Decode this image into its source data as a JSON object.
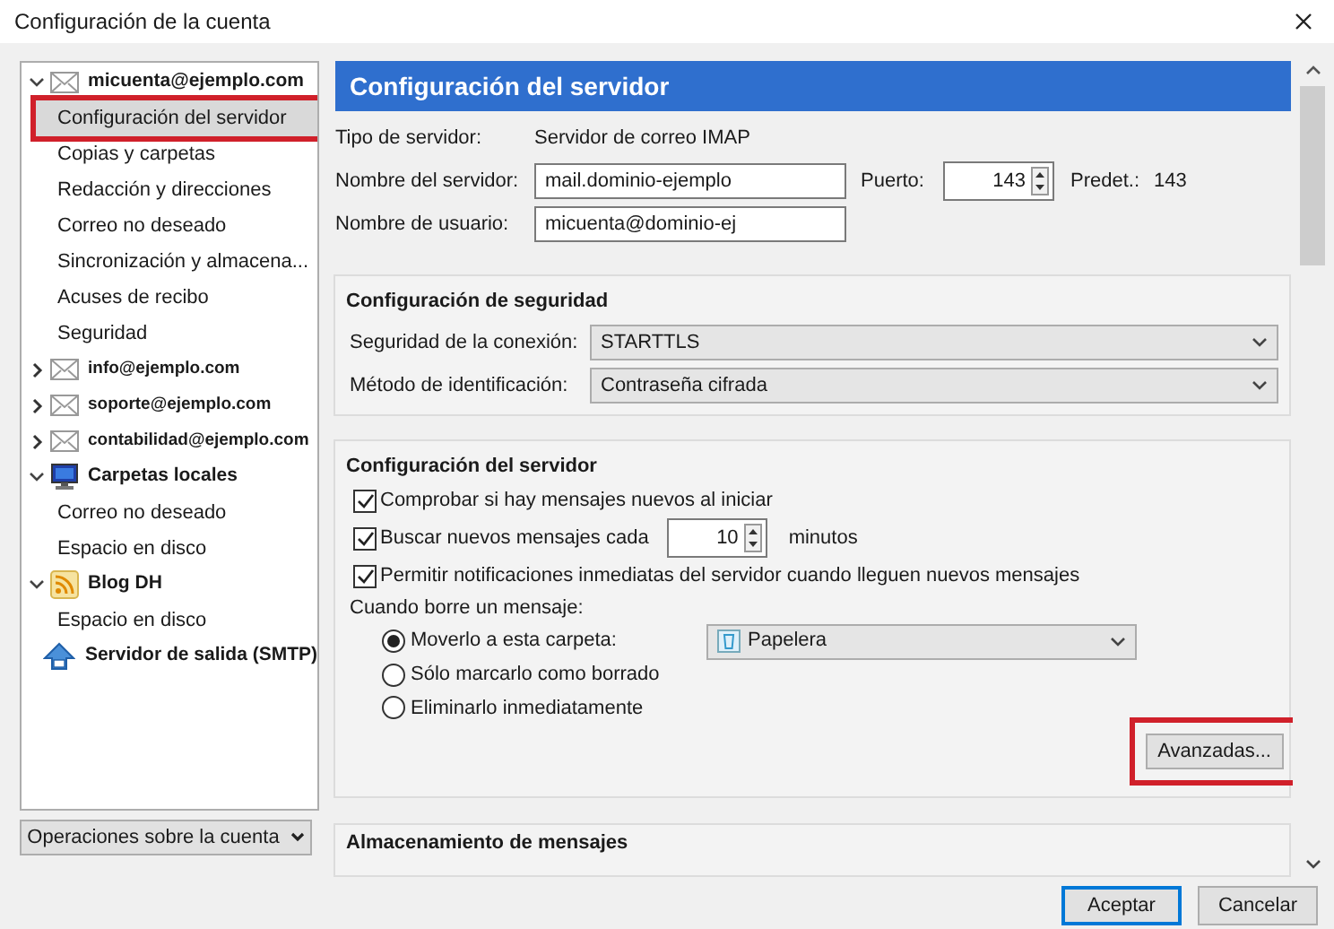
{
  "window": {
    "title": "Configuración de la cuenta"
  },
  "sidebar": {
    "items": [
      {
        "label": "micuenta@ejemplo.com",
        "kind": "mail",
        "expanded": true,
        "children": [
          {
            "label": "Configuración del servidor",
            "selected": true,
            "highlighted": true
          },
          {
            "label": "Copias y carpetas",
            "selected": false,
            "highlighted": false
          },
          {
            "label": "Redacción y direcciones",
            "selected": false,
            "highlighted": false
          },
          {
            "label": "Correo no deseado",
            "selected": false,
            "highlighted": false
          },
          {
            "label": "Sincronización y almacena...",
            "selected": false,
            "highlighted": false
          },
          {
            "label": "Acuses de recibo",
            "selected": false,
            "highlighted": false
          },
          {
            "label": "Seguridad",
            "selected": false,
            "highlighted": false
          }
        ]
      },
      {
        "label": "info@ejemplo.com",
        "kind": "mail",
        "expanded": false
      },
      {
        "label": "soporte@ejemplo.com",
        "kind": "mail",
        "expanded": false
      },
      {
        "label": "contabilidad@ejemplo.com",
        "kind": "mail",
        "expanded": false
      },
      {
        "label": "Carpetas locales",
        "kind": "computer",
        "expanded": true,
        "children": [
          {
            "label": "Correo no deseado",
            "selected": false,
            "highlighted": false
          },
          {
            "label": "Espacio en disco",
            "selected": false,
            "highlighted": false
          }
        ]
      },
      {
        "label": "Blog DH",
        "kind": "feed",
        "expanded": true,
        "children": [
          {
            "label": "Espacio en disco",
            "selected": false,
            "highlighted": false
          }
        ]
      },
      {
        "label": "Servidor de salida (SMTP)",
        "kind": "outgoing"
      }
    ],
    "account_actions": "Operaciones sobre la cuenta"
  },
  "panel": {
    "header": "Configuración del servidor",
    "server_type": {
      "label": "Tipo de servidor:",
      "value": "Servidor de correo IMAP"
    },
    "server_name": {
      "label": "Nombre del servidor:",
      "value": "mail.dominio-ejemplo"
    },
    "port": {
      "label": "Puerto:",
      "value": "143",
      "default_label": "Predet.:",
      "default_value": "143"
    },
    "username": {
      "label": "Nombre de usuario:",
      "value": "micuenta@dominio-ej"
    },
    "security": {
      "title": "Configuración de seguridad",
      "connection": {
        "label": "Seguridad de la conexión:",
        "value": "STARTTLS"
      },
      "auth": {
        "label": "Método de identificación:",
        "value": "Contraseña cifrada"
      }
    },
    "server_settings": {
      "title": "Configuración del servidor",
      "check_on_start": {
        "label": "Comprobar si hay mensajes nuevos al iniciar",
        "checked": true
      },
      "check_every": {
        "label": "Buscar nuevos mensajes cada",
        "checked": true,
        "value": "10",
        "unit": "minutos"
      },
      "push": {
        "label": "Permitir notificaciones inmediatas del servidor cuando lleguen nuevos mensajes",
        "checked": true
      },
      "on_delete": "Cuando borre un mensaje:",
      "delete_options": [
        {
          "label": "Moverlo a esta carpeta:",
          "selected": true,
          "folder": "Papelera"
        },
        {
          "label": "Sólo marcarlo como borrado",
          "selected": false
        },
        {
          "label": "Eliminarlo inmediatamente",
          "selected": false
        }
      ],
      "advanced": {
        "label": "Avanzadas...",
        "highlighted": true
      }
    },
    "storage": {
      "title": "Almacenamiento de mensajes"
    }
  },
  "buttons": [
    {
      "label": "Aceptar",
      "default": true
    },
    {
      "label": "Cancelar",
      "default": false
    }
  ]
}
